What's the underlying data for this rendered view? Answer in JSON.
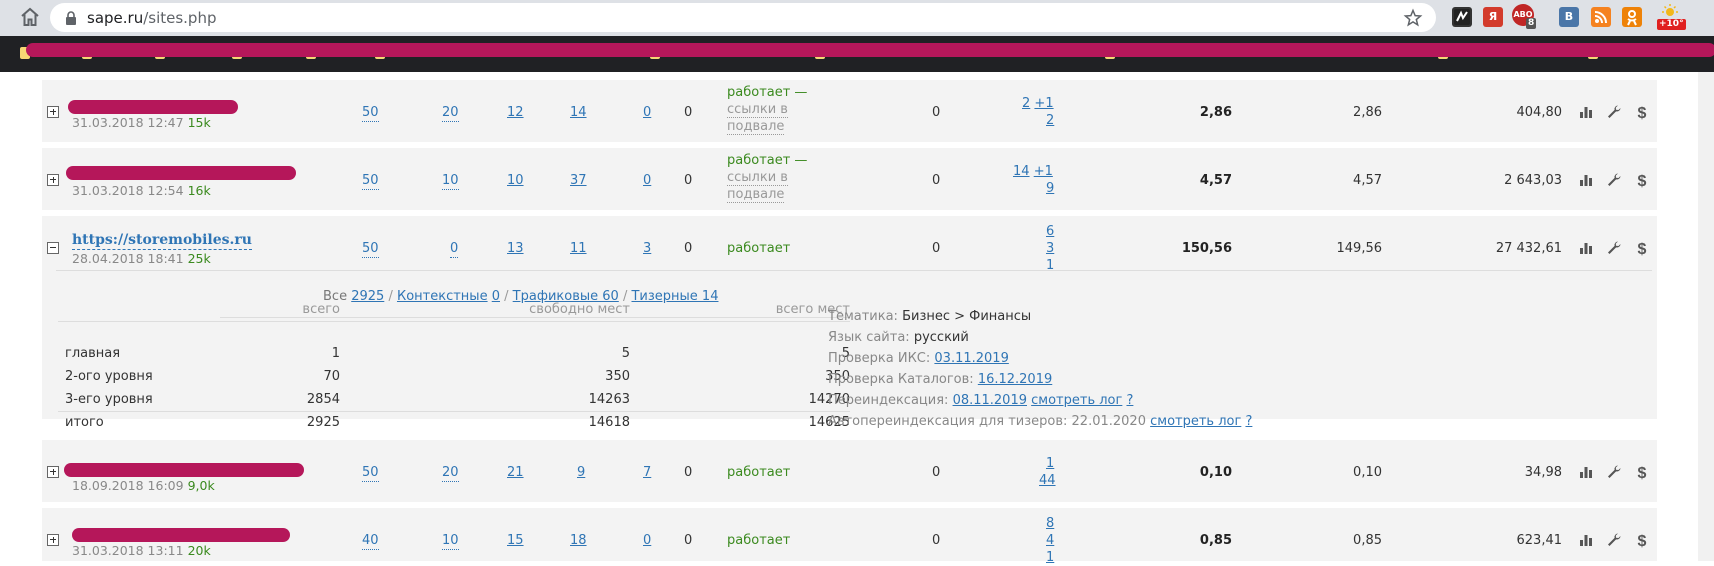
{
  "browser": {
    "url_host": "sape.ru",
    "url_path": "/sites.php",
    "extensions": [
      {
        "name": "ext-blackbox-icon",
        "label": "",
        "color": "#555555"
      },
      {
        "name": "ext-yandex-icon",
        "label": "Я",
        "color": "#d33b2c"
      },
      {
        "name": "ext-abo-icon",
        "label": "ABO",
        "color": "#c02626",
        "badge": "8"
      },
      {
        "name": "ext-vk-icon",
        "label": "В",
        "color": "#4a76a8"
      },
      {
        "name": "ext-rss-icon",
        "label": "",
        "color": "#f58220"
      },
      {
        "name": "ext-ok-icon",
        "label": "",
        "color": "#ee8208"
      },
      {
        "name": "ext-weather-icon",
        "label": "",
        "color": "#dee1e6",
        "badge": "+10°"
      }
    ]
  },
  "colors": {
    "link": "#2f75b5",
    "green": "#3b8a1f",
    "row_bg": "#f3f3f3",
    "redaction": "#b5175a"
  },
  "sites": [
    {
      "date": "31.03.2018 12:47",
      "traffic": "15k",
      "c1": "50",
      "c2": "20",
      "c3": "12",
      "c4": "14",
      "c5": "0",
      "c6": "0",
      "status": "работает —",
      "status_sub1": "ссылки в",
      "status_sub2": "подвале",
      "c7": "0",
      "ref_a": "2",
      "ref_plus": "+1",
      "ref_b": "2",
      "v1": "2,86",
      "v2": "2,86",
      "v3": "404,80"
    },
    {
      "date": "31.03.2018 12:54",
      "traffic": "16k",
      "c1": "50",
      "c2": "10",
      "c3": "10",
      "c4": "37",
      "c5": "0",
      "c6": "0",
      "status": "работает —",
      "status_sub1": "ссылки в",
      "status_sub2": "подвале",
      "c7": "0",
      "ref_a": "14",
      "ref_plus": "+1",
      "ref_b": "9",
      "v1": "4,57",
      "v2": "4,57",
      "v3": "2 643,03"
    },
    {
      "url": "https://storemobiles.ru",
      "date": "28.04.2018 18:41",
      "traffic": "25k",
      "c1": "50",
      "c2": "0",
      "c3": "13",
      "c4": "11",
      "c5": "3",
      "c6": "0",
      "status": "работает",
      "c7": "0",
      "ref_a": "6",
      "ref_b": "3",
      "ref_c": "1",
      "v1": "150,56",
      "v2": "149,56",
      "v3": "27 432,61"
    },
    {
      "date": "18.09.2018 16:09",
      "traffic": "9,0k",
      "c1": "50",
      "c2": "20",
      "c3": "21",
      "c4": "9",
      "c5": "7",
      "c6": "0",
      "status": "работает",
      "c7": "0",
      "ref_a": "1",
      "ref_b": "44",
      "v1": "0,10",
      "v2": "0,10",
      "v3": "34,98"
    },
    {
      "date": "31.03.2018 13:11",
      "traffic": "20k",
      "c1": "40",
      "c2": "10",
      "c3": "15",
      "c4": "18",
      "c5": "0",
      "c6": "0",
      "status": "работает",
      "c7": "0",
      "ref_a": "8",
      "ref_b": "4",
      "ref_c": "1",
      "v1": "0,85",
      "v2": "0,85",
      "v3": "623,41"
    }
  ],
  "detail": {
    "filter": {
      "all_label": "Все",
      "all_count": "2925",
      "context_label": "Контекстные",
      "context_count": "0",
      "traffic_label": "Трафиковые 60",
      "teaser_label": "Тизерные 14"
    },
    "inventory": {
      "headers": [
        "всего",
        "свободно мест",
        "всего мест"
      ],
      "rows": [
        {
          "label": "главная",
          "total": "1",
          "free": "5",
          "places": "5"
        },
        {
          "label": "2-ого уровня",
          "total": "70",
          "free": "350",
          "places": "350"
        },
        {
          "label": "3-его уровня",
          "total": "2854",
          "free": "14263",
          "places": "14270"
        },
        {
          "label": "итого",
          "total": "2925",
          "free": "14618",
          "places": "14625"
        }
      ]
    },
    "info": {
      "topic_label": "Тематика:",
      "topic_value": "Бизнес > Финансы",
      "lang_label": "Язык сайта:",
      "lang_value": "русский",
      "iks_label": "Проверка ИКС:",
      "iks_value": "03.11.2019",
      "catalog_label": "Проверка Каталогов:",
      "catalog_value": "16.12.2019",
      "reindex_label": "Переиндексация:",
      "reindex_value": "08.11.2019",
      "reindex_log": "смотреть лог",
      "reindex_q": "?",
      "auto_label": "Автопереиндексация для тизеров: 22.01.2020",
      "auto_log": "смотреть лог",
      "auto_q": "?"
    }
  }
}
